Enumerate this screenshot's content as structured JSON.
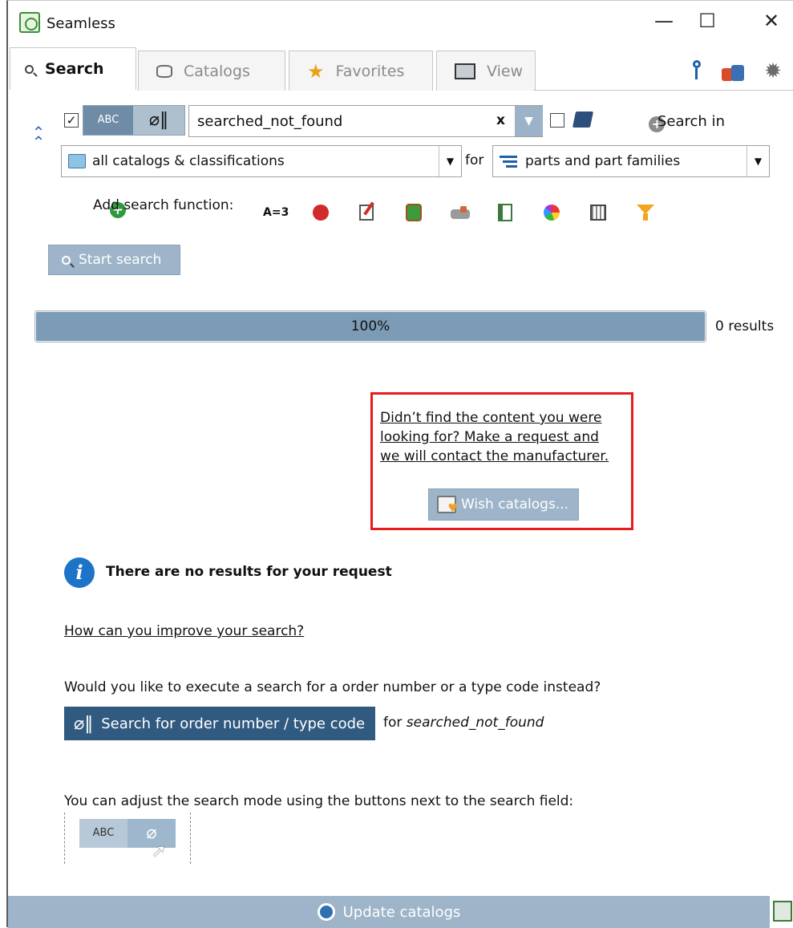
{
  "window": {
    "title": "Seamless",
    "minimize": "—",
    "maximize": "☐",
    "close": "✕"
  },
  "tabs": [
    {
      "label": "Search",
      "icon": "magnifier-icon",
      "active": true
    },
    {
      "label": "Catalogs",
      "icon": "database-icon",
      "active": false
    },
    {
      "label": "Favorites",
      "icon": "star-icon",
      "active": false
    },
    {
      "label": "View",
      "icon": "view-icon",
      "active": false
    }
  ],
  "search": {
    "mode_abc": "ABC",
    "mode_ordnum": "⌀‖",
    "value": "searched_not_found",
    "clear": "x",
    "dropdown": "▼",
    "search_in_label": "Search in",
    "scope": "all catalogs & classifications",
    "for_label": "for",
    "target": "parts and part families",
    "add_function_label": "Add search function:",
    "start_button": "Start search"
  },
  "progress": {
    "value": 1.0,
    "label": "100%",
    "results": "0 results"
  },
  "wish": {
    "line1": "Didn’t find the content you were",
    "line2": "looking for? Make a request and",
    "line3": "we will contact the manufacturer.",
    "button": "Wish catalogs..."
  },
  "info": {
    "heading": "There are no results for your request",
    "improve_link": "How can you improve your search?",
    "question": "Would you like to execute a search for a order number or a type code instead?",
    "ordnum_button": "Search for order number / type code",
    "for_prefix": "for",
    "for_term": "searched_not_found",
    "adjust_text": "You can adjust the search mode using the buttons next to the search field:",
    "demo_abc": "ABC",
    "demo_ordnum": "⌀"
  },
  "footer": {
    "update_button": "Update catalogs"
  },
  "colors": {
    "accent_button": "#9db4c9",
    "dark_button": "#315a80",
    "progress_fill": "#7c9bb6",
    "highlight_border": "#e81c1c",
    "info_blue": "#1d73c7"
  }
}
